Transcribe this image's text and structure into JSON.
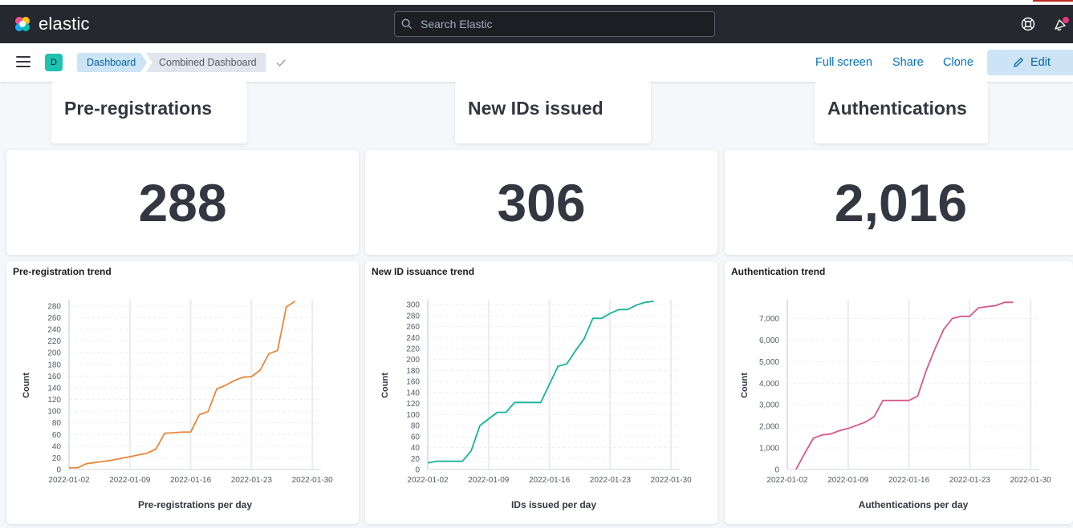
{
  "app": {
    "brand": "elastic",
    "search_placeholder": "Search Elastic"
  },
  "icons": [
    "elastic-logo-icon",
    "search-icon",
    "help-icon",
    "newsfeed-icon",
    "menu-icon",
    "check-icon",
    "pencil-icon"
  ],
  "colors": {
    "topbar": "#25282f",
    "accent": "#0071c2",
    "edit_bg": "#cce4f5",
    "space": "#1ec2b0",
    "notify": "#e7377d"
  },
  "nav": {
    "space_initial": "D",
    "breadcrumbs": [
      "Dashboard",
      "Combined Dashboard"
    ],
    "actions": {
      "fullscreen": "Full screen",
      "share": "Share",
      "clone": "Clone",
      "edit": "Edit"
    }
  },
  "panels": {
    "titles": [
      "Pre-registrations",
      "New IDs issued",
      "Authentications"
    ],
    "metrics": [
      "288",
      "306",
      "2,016"
    ]
  },
  "chart_data": [
    {
      "type": "line",
      "title": "Pre-registration trend",
      "xlabel": "Pre-registrations per day",
      "ylabel": "Count",
      "color": "#e7873b",
      "x_start": "2022-01-02",
      "x_ticks": [
        "2022-01-02",
        "2022-01-09",
        "2022-01-16",
        "2022-01-23",
        "2022-01-30"
      ],
      "xlim": [
        "2022-01-02",
        "2022-01-31"
      ],
      "y_ticks": [
        "0",
        "20",
        "40",
        "60",
        "80",
        "100",
        "120",
        "140",
        "160",
        "180",
        "200",
        "220",
        "240",
        "260",
        "280"
      ],
      "ylim": [
        0,
        288
      ],
      "grid": true,
      "x": [
        "2022-01-02",
        "2022-01-03",
        "2022-01-04",
        "2022-01-05",
        "2022-01-06",
        "2022-01-07",
        "2022-01-08",
        "2022-01-09",
        "2022-01-10",
        "2022-01-11",
        "2022-01-12",
        "2022-01-13",
        "2022-01-14",
        "2022-01-15",
        "2022-01-16",
        "2022-01-17",
        "2022-01-18",
        "2022-01-19",
        "2022-01-20",
        "2022-01-21",
        "2022-01-22",
        "2022-01-23",
        "2022-01-24",
        "2022-01-25",
        "2022-01-26",
        "2022-01-27",
        "2022-01-28"
      ],
      "values": [
        3,
        3,
        10,
        12,
        14,
        16,
        19,
        22,
        25,
        28,
        35,
        62,
        63,
        64,
        64,
        94,
        99,
        138,
        144,
        152,
        158,
        159,
        170,
        198,
        204,
        278,
        288
      ]
    },
    {
      "type": "line",
      "title": "New ID issuance trend",
      "xlabel": "IDs issued per day",
      "ylabel": "Count",
      "color": "#16b39a",
      "x_start": "2022-01-02",
      "x_ticks": [
        "2022-01-02",
        "2022-01-09",
        "2022-01-16",
        "2022-01-23",
        "2022-01-30"
      ],
      "xlim": [
        "2022-01-02",
        "2022-01-31"
      ],
      "y_ticks": [
        "0",
        "20",
        "40",
        "60",
        "80",
        "100",
        "120",
        "140",
        "160",
        "180",
        "200",
        "220",
        "240",
        "260",
        "280",
        "300"
      ],
      "ylim": [
        0,
        306
      ],
      "grid": true,
      "x": [
        "2022-01-02",
        "2022-01-03",
        "2022-01-04",
        "2022-01-05",
        "2022-01-06",
        "2022-01-07",
        "2022-01-08",
        "2022-01-09",
        "2022-01-10",
        "2022-01-11",
        "2022-01-12",
        "2022-01-13",
        "2022-01-14",
        "2022-01-15",
        "2022-01-16",
        "2022-01-17",
        "2022-01-18",
        "2022-01-19",
        "2022-01-20",
        "2022-01-21",
        "2022-01-22",
        "2022-01-23",
        "2022-01-24",
        "2022-01-25",
        "2022-01-26",
        "2022-01-27",
        "2022-01-28"
      ],
      "values": [
        12,
        15,
        15,
        15,
        15,
        34,
        80,
        92,
        104,
        104,
        122,
        122,
        122,
        122,
        155,
        188,
        192,
        216,
        238,
        275,
        275,
        284,
        291,
        291,
        299,
        304,
        306
      ]
    },
    {
      "type": "line",
      "title": "Authentication trend",
      "xlabel": "Authentications per day",
      "ylabel": "Count",
      "color": "#d6588a",
      "x_start": "2022-01-02",
      "x_ticks": [
        "2022-01-02",
        "2022-01-09",
        "2022-01-16",
        "2022-01-23",
        "2022-01-30"
      ],
      "xlim": [
        "2022-01-02",
        "2022-01-31"
      ],
      "y_ticks": [
        "0",
        "1,000",
        "2,000",
        "3,000",
        "4,000",
        "5,000",
        "6,000",
        "7,000"
      ],
      "ylim": [
        0,
        7800
      ],
      "grid": true,
      "x": [
        "2022-01-03",
        "2022-01-04",
        "2022-01-05",
        "2022-01-06",
        "2022-01-07",
        "2022-01-08",
        "2022-01-09",
        "2022-01-10",
        "2022-01-11",
        "2022-01-12",
        "2022-01-13",
        "2022-01-14",
        "2022-01-15",
        "2022-01-16",
        "2022-01-17",
        "2022-01-18",
        "2022-01-19",
        "2022-01-20",
        "2022-01-21",
        "2022-01-22",
        "2022-01-23",
        "2022-01-24",
        "2022-01-25",
        "2022-01-26",
        "2022-01-27",
        "2022-01-28"
      ],
      "values": [
        0,
        750,
        1450,
        1600,
        1650,
        1800,
        1900,
        2050,
        2200,
        2450,
        3200,
        3200,
        3200,
        3200,
        3400,
        4600,
        5600,
        6500,
        7000,
        7100,
        7100,
        7500,
        7550,
        7600,
        7750,
        7750
      ]
    }
  ]
}
